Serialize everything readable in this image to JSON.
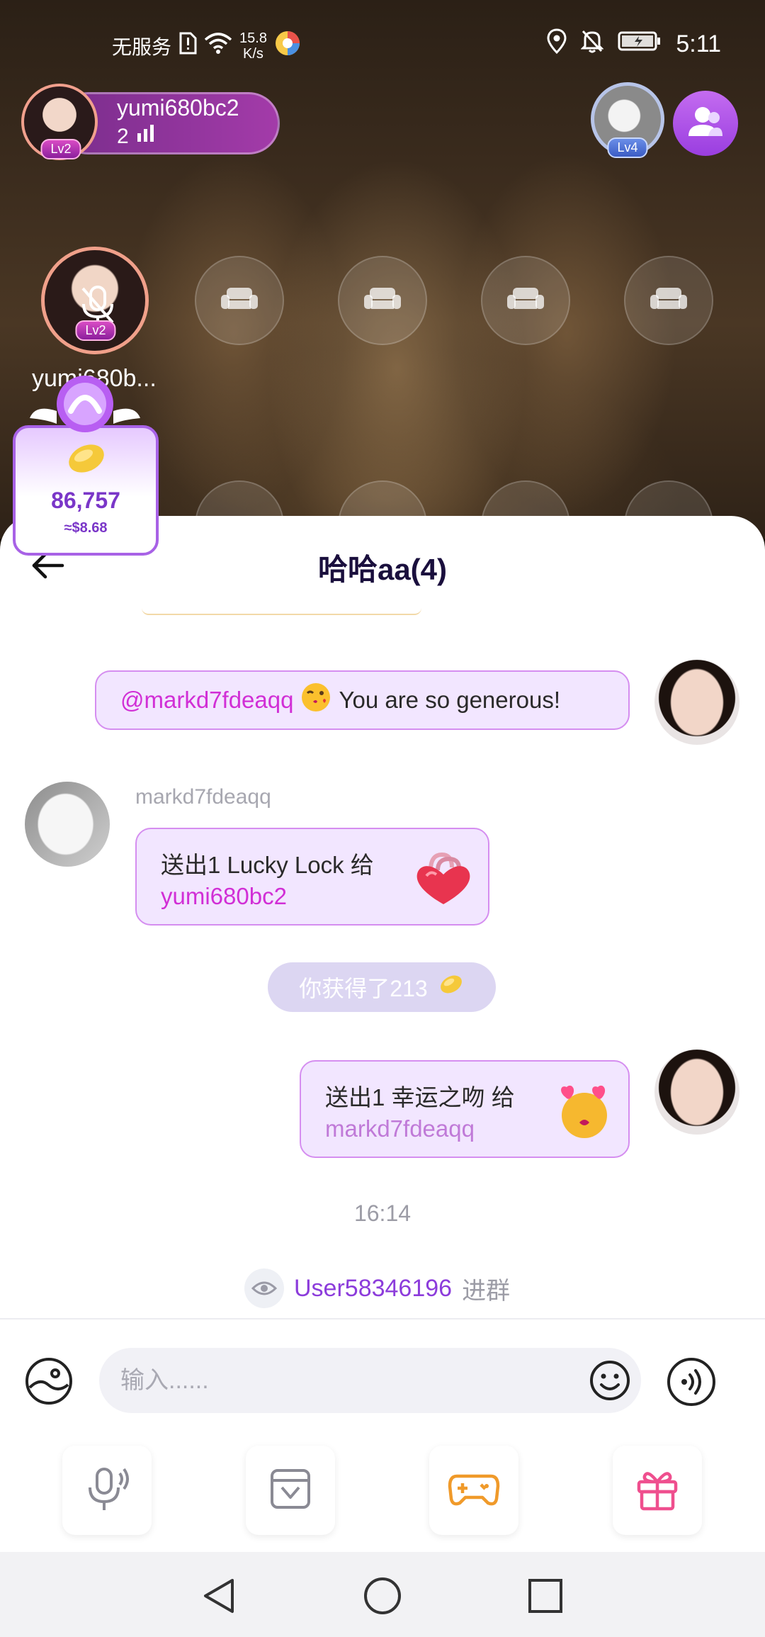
{
  "status_bar": {
    "carrier": "无服务",
    "net_speed_value": "15.8",
    "net_speed_unit": "K/s",
    "time": "5:11"
  },
  "room": {
    "host_name": "yumi680bc2",
    "host_level": "Lv2",
    "online_count": "2",
    "top_right_level": "Lv4",
    "seat_host_level": "Lv2",
    "seat_host_name": "yumi680b...",
    "coins": "86,757",
    "coins_usd": "≈$8.68"
  },
  "chat": {
    "title": "哈哈aa(4)",
    "messages": [
      {
        "mention": "@markd7fdeaqq",
        "text": "You are so generous!"
      },
      {
        "sender": "markd7fdeaqq",
        "gift_text": "送出1 Lucky Lock 给",
        "gift_target": "yumi680bc2"
      },
      {
        "gift_text": "送出1 幸运之吻 给",
        "gift_target": "markd7fdeaqq"
      }
    ],
    "system_reward": "你获得了213",
    "timestamp": "16:14",
    "join_user": "User58346196",
    "join_text": "进群"
  },
  "input": {
    "placeholder": "输入......"
  },
  "colors": {
    "accent_purple": "#8c3cdb",
    "mention_pink": "#d12fd6",
    "bubble_bg": "#f2e6ff",
    "bubble_border": "#d58ef0"
  }
}
